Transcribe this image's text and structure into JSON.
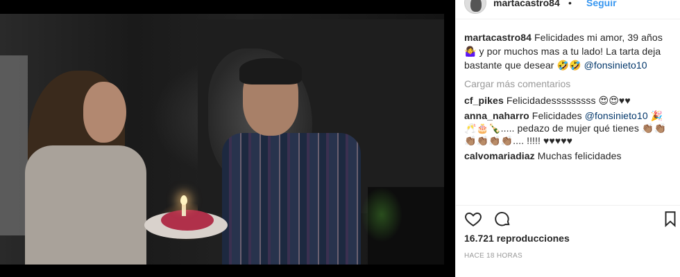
{
  "post": {
    "username": "martacastro84",
    "separator": "•",
    "follow_label": "Seguir",
    "caption": {
      "user": "martacastro84",
      "text": "Felicidades mi amor, 39 años 🤷‍♀️ y por muchos mas a tu lado! La tarta deja bastante que desear 🤣🤣",
      "mention": "@fonsinieto10"
    },
    "load_more": "Cargar más comentarios",
    "comments": [
      {
        "user": "cf_pikes",
        "text": "Felicidadesssssssss 😍😍♥♥"
      },
      {
        "user": "anna_naharro",
        "text": "Felicidades ",
        "mention": "@fonsinieto10",
        "text_after": " 🎉🥂🎂🍾..... pedazo de mujer qué tienes 👏🏽👏🏽👏🏽👏🏽👏🏽👏🏽.... !!!!! ♥♥♥♥♥"
      },
      {
        "user": "calvomariadiaz",
        "text": "Muchas felicidades"
      },
      {
        "user": "",
        "text": ""
      }
    ],
    "views_count": "16.721",
    "views_label": "reproducciones",
    "timestamp": "Hace 18 horas"
  },
  "icons": {
    "like": "heart-icon",
    "comment": "comment-icon",
    "save": "bookmark-icon",
    "avatar": "avatar"
  },
  "colors": {
    "follow": "#3897f0",
    "mention": "#003569",
    "muted": "#999999",
    "text": "#262626"
  }
}
